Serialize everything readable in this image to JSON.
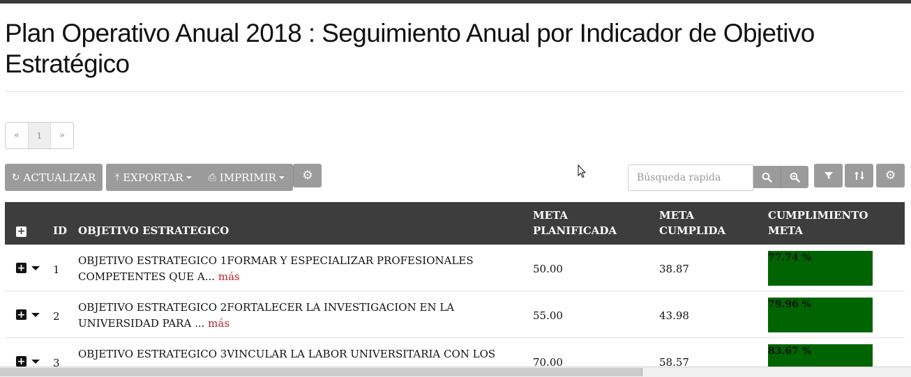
{
  "page": {
    "title": "Plan Operativo Anual 2018 : Seguimiento Anual por Indicador de Objetivo Estratégico"
  },
  "pagination": {
    "prev": "«",
    "current": "1",
    "next": "»"
  },
  "toolbar": {
    "refresh_label": "ACTUALIZAR",
    "export_label": "EXPORTAR",
    "print_label": "IMPRIMIR",
    "search_placeholder": "Búsqueda rapida"
  },
  "icons": {
    "refresh": "refresh-icon",
    "export": "export-icon",
    "print": "print-icon",
    "settings": "gear-icon",
    "search": "search-icon",
    "zoom_out": "zoom-out-icon",
    "filter": "filter-icon",
    "sort": "sort-icon"
  },
  "table": {
    "headers": {
      "expand": "+",
      "id": "ID",
      "objective": "OBJETIVO ESTRATEGICO",
      "planned_1": "META",
      "planned_2": "PLANIFICADA",
      "achieved_1": "META",
      "achieved_2": "CUMPLIDA",
      "compliance_1": "CUMPLIMIENTO",
      "compliance_2": "META"
    },
    "more_label": "más",
    "rows": [
      {
        "id": "1",
        "objective_1": "OBJETIVO ESTRATEGICO 1FORMAR Y ESPECIALIZAR PROFESIONALES",
        "objective_2": "COMPETENTES QUE A...",
        "planned": "50.00",
        "achieved": "38.87",
        "compliance": "77.74 %",
        "compliance_value": 77.74
      },
      {
        "id": "2",
        "objective_1": "OBJETIVO ESTRATEGICO 2FORTALECER LA INVESTIGACION EN LA",
        "objective_2": "UNIVERSIDAD PARA ...",
        "planned": "55.00",
        "achieved": "43.98",
        "compliance": "79.96 %",
        "compliance_value": 79.96
      },
      {
        "id": "3",
        "objective_1": "OBJETIVO ESTRATEGICO 3VINCULAR LA LABOR UNIVERSITARIA CON LOS",
        "objective_2": "",
        "planned": "70.00",
        "achieved": "58.57",
        "compliance": "83.67 %",
        "compliance_value": 83.67
      }
    ]
  },
  "colors": {
    "header_bg": "#3d3d3d",
    "button_bg": "#9b9b9b",
    "bar_fill": "#006400",
    "more_link": "#b8232f"
  }
}
